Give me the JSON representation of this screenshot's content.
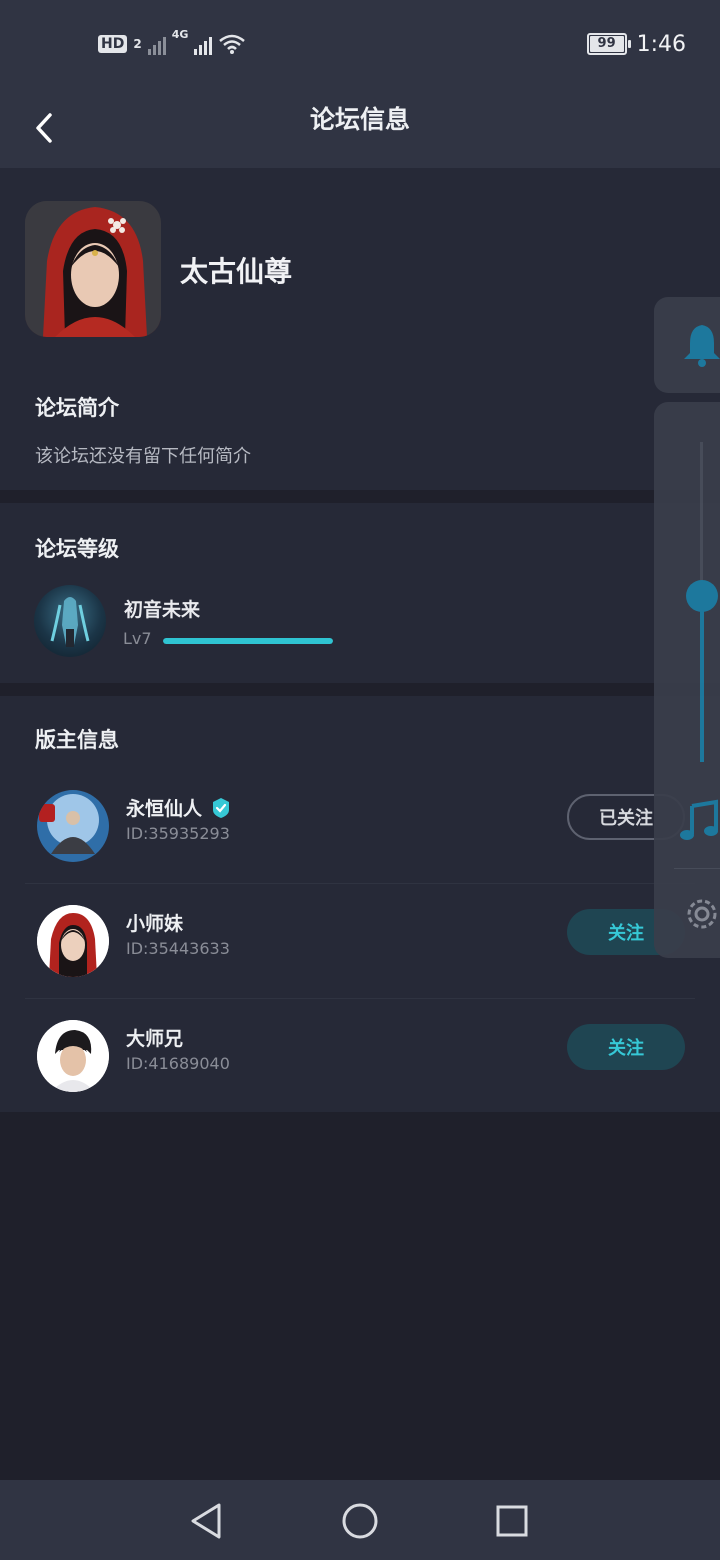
{
  "status_bar": {
    "hd_label": "HD",
    "sim_badge": "2",
    "network_type": "4G",
    "battery_level": "99",
    "time": "1:46"
  },
  "navbar": {
    "title": "论坛信息",
    "back_icon": "chevron-left-icon"
  },
  "forum": {
    "name": "太古仙尊"
  },
  "intro": {
    "title": "论坛简介",
    "text": "该论坛还没有留下任何简介"
  },
  "level": {
    "title": "论坛等级",
    "name": "初音未来",
    "level_label": "Lv7",
    "progress_fraction": 1.0
  },
  "moderators": {
    "title": "版主信息",
    "list": [
      {
        "name": "永恒仙人",
        "id": "ID:35935293",
        "verified": true,
        "button": "已关注",
        "followed": true
      },
      {
        "name": "小师妹",
        "id": "ID:35443633",
        "verified": false,
        "button": "关注",
        "followed": false
      },
      {
        "name": "大师兄",
        "id": "ID:41689040",
        "verified": false,
        "button": "关注",
        "followed": false
      }
    ]
  },
  "floating_panel": {
    "icons": [
      "bell-icon",
      "music-note-icon",
      "settings-gear-icon"
    ],
    "volume_fraction": 0.52
  },
  "system_nav": {
    "icons": [
      "nav-back-icon",
      "nav-home-icon",
      "nav-recents-icon"
    ]
  },
  "colors": {
    "accent": "#36c8d6",
    "background": "#1f202b",
    "card": "#262937",
    "bar": "#303443"
  }
}
